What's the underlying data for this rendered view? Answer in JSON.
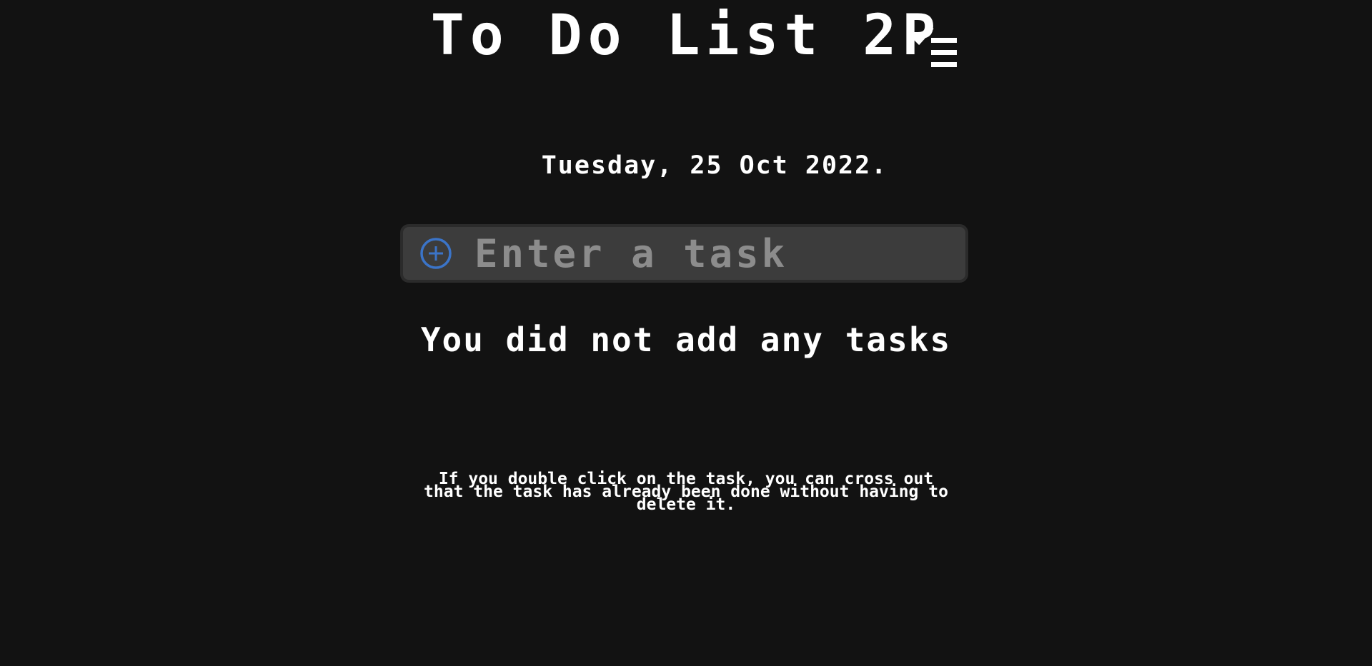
{
  "header": {
    "title": "To Do List 2P",
    "icon": "checklist-icon"
  },
  "date": "Tuesday, 25 Oct 2022.",
  "task_input": {
    "value": "",
    "placeholder": "Enter a task",
    "add_icon": "plus-circle-icon",
    "accent": "#3b74c8"
  },
  "empty_message": "You did not add any tasks",
  "hint": "If you double click on the task, you can cross out that the task has already been done without having to delete it.",
  "colors": {
    "background": "#121212",
    "input_background": "#3c3c3c",
    "placeholder": "#8c8c8c",
    "text": "#ffffff"
  }
}
